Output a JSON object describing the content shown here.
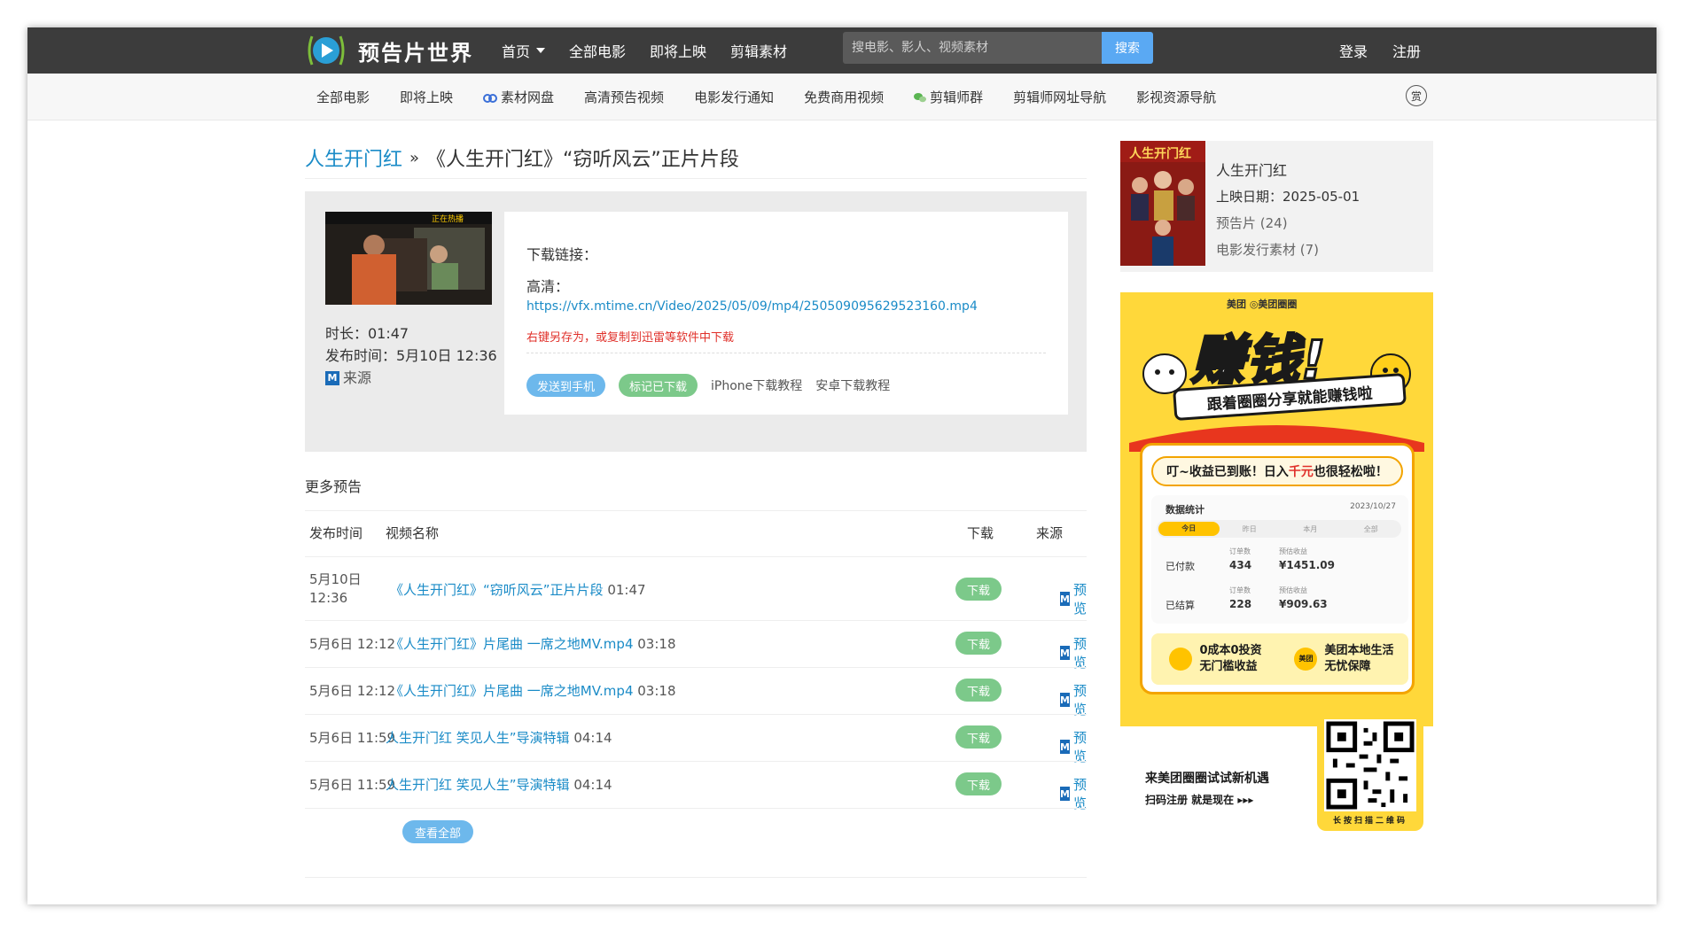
{
  "header": {
    "site_name": "预告片世界",
    "nav": [
      "首页",
      "全部电影",
      "即将上映",
      "剪辑素材"
    ],
    "search_placeholder": "搜电影、影人、视频素材",
    "search_button": "搜索",
    "login": "登录",
    "register": "注册"
  },
  "subnav": {
    "items": [
      "全部电影",
      "即将上映",
      "素材网盘",
      "高清预告视频",
      "电影发行通知",
      "免费商用视频",
      "剪辑师群",
      "剪辑师网址导航",
      "影视资源导航"
    ],
    "reward_label": "赏"
  },
  "breadcrumb": {
    "movie": "人生开门红",
    "separator": "»",
    "current": "《人生开门红》“窃听风云”正片片段"
  },
  "video": {
    "thumb_badge": "正在热播",
    "duration": "时长：01:47",
    "published": "发布时间：5月10日 12:36",
    "source_icon": "M",
    "source": "来源",
    "download_title": "下载链接：",
    "hd_label": "高清：",
    "url": "https://vfx.mtime.cn/Video/2025/05/09/mp4/250509095629523160.mp4",
    "hint": "右键另存为，或复制到迅雷等软件中下载",
    "send_to_phone": "发送到手机",
    "mark_downloaded": "标记已下载",
    "iphone_tutorial": "iPhone下载教程",
    "android_tutorial": "安卓下载教程"
  },
  "more": {
    "title": "更多预告",
    "columns": [
      "发布时间",
      "视频名称",
      "下载",
      "来源"
    ],
    "download_label": "下载",
    "preview_label": "预览",
    "view_all": "查看全部",
    "rows": [
      {
        "date": "5月10日",
        "time": "12:36",
        "title": "《人生开门红》“窃听风云”正片片段",
        "dur": "01:47"
      },
      {
        "date": "5月6日 12:12",
        "time": "",
        "title": "《人生开门红》片尾曲 一席之地MV.mp4",
        "dur": "03:18"
      },
      {
        "date": "5月6日 12:12",
        "time": "",
        "title": "《人生开门红》片尾曲 一席之地MV.mp4",
        "dur": "03:18"
      },
      {
        "date": "5月6日 11:59",
        "time": "",
        "title": "人生开门红 笑见人生”导演特辑",
        "dur": "04:14"
      },
      {
        "date": "5月6日 11:59",
        "time": "",
        "title": "人生开门红 笑见人生”导演特辑",
        "dur": "04:14"
      }
    ]
  },
  "movie_card": {
    "title": "人生开门红",
    "release": "上映日期：2025-05-01",
    "trailers": "预告片 (24)",
    "materials": "电影发行素材 (7)",
    "poster_text": "人生开门红"
  },
  "ad": {
    "brand": "美团 ◎美团圈圈",
    "headline": "赚钱!",
    "banner": "跟着圈圈分享就能赚钱啦",
    "card_title_pre": "叮~收益已到账！日入",
    "card_title_red": "千元",
    "card_title_post": "也很轻松啦！",
    "stats_label": "数据统计",
    "stats_date": "2023/10/27",
    "stats_tabs": [
      "今日",
      "昨日",
      "本月",
      "全部"
    ],
    "orders_label": "订单数",
    "income_label": "预估收益",
    "paid_label": "已付款",
    "paid_orders": "434",
    "paid_income": "¥1451.09",
    "settled_label": "已结算",
    "settled_orders": "228",
    "settled_income": "¥909.63",
    "promo1_a": "0成本0投资",
    "promo1_b": "无门槛收益",
    "promo2_a": "美团本地生活",
    "promo2_b": "无忧保障",
    "promo2_icon": "美团",
    "bottom_1": "来美团圈圈试试新机遇",
    "bottom_2": "扫码注册 就是现在 ▸▸▸",
    "qr_caption": "长按扫描二维码"
  },
  "colors": {
    "topbar": "#3c3c3c",
    "link": "#1a8bc7",
    "search_button": "#5aa9f3",
    "green_button": "#7cc98a",
    "blue_button": "#6db8ec",
    "hint_red": "#e0302a",
    "ad_yellow": "#ffd83a"
  }
}
